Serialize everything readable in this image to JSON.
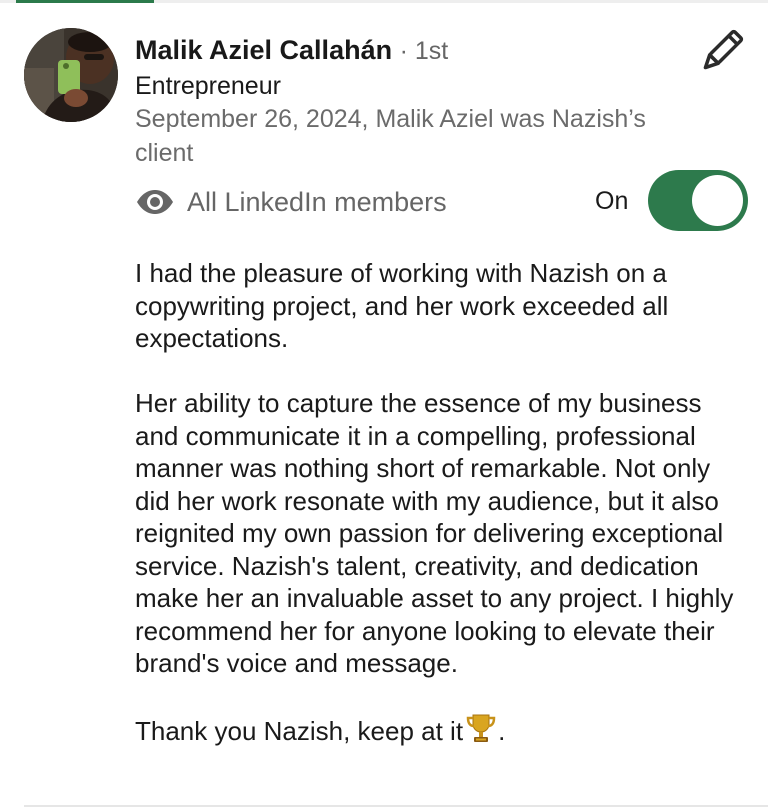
{
  "author": {
    "name": "Malik Aziel Callahán",
    "degree": "· 1st",
    "headline": "Entrepreneur",
    "meta": "September 26, 2024, Malik Aziel was Nazish’s client"
  },
  "visibility": {
    "icon": "eye-icon",
    "label": "All LinkedIn members",
    "toggle_label": "On",
    "toggle_on": true,
    "accent_color": "#2d7a4c"
  },
  "edit": {
    "icon": "pencil-icon"
  },
  "recommendation": {
    "paragraphs": [
      "I had the pleasure of working with Nazish on a copywriting project, and her work exceeded all expectations.",
      "Her ability to capture the essence of my business and communicate it in a compelling, professional manner was nothing short of remarkable. Not only did her work resonate with my audience, but it also reignited my own passion for delivering exceptional service. Nazish's talent, creativity, and dedication make her an invaluable asset to any project. I highly recommend her for anyone looking to elevate their brand's voice and message."
    ],
    "closing": "Thank you Nazish, keep at it",
    "closing_icon": "trophy-icon",
    "closing_end": "."
  }
}
